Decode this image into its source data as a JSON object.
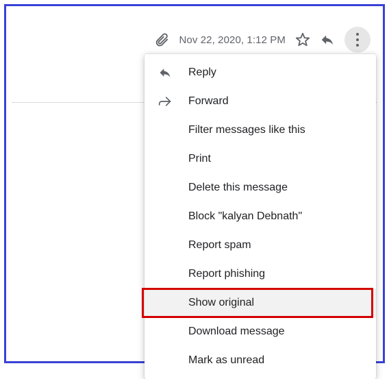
{
  "header": {
    "timestamp": "Nov 22, 2020, 1:12 PM",
    "attachment_icon": "paperclip-icon",
    "star_icon": "star-icon",
    "reply_icon": "reply-icon",
    "more_icon": "more-vert-icon"
  },
  "menu": {
    "items": [
      {
        "label": "Reply",
        "icon": "reply-icon"
      },
      {
        "label": "Forward",
        "icon": "forward-icon"
      },
      {
        "label": "Filter messages like this"
      },
      {
        "label": "Print"
      },
      {
        "label": "Delete this message"
      },
      {
        "label": "Block \"kalyan Debnath\""
      },
      {
        "label": "Report spam"
      },
      {
        "label": "Report phishing"
      },
      {
        "label": "Show original",
        "highlighted": true
      },
      {
        "label": "Download message"
      },
      {
        "label": "Mark as unread"
      }
    ]
  }
}
